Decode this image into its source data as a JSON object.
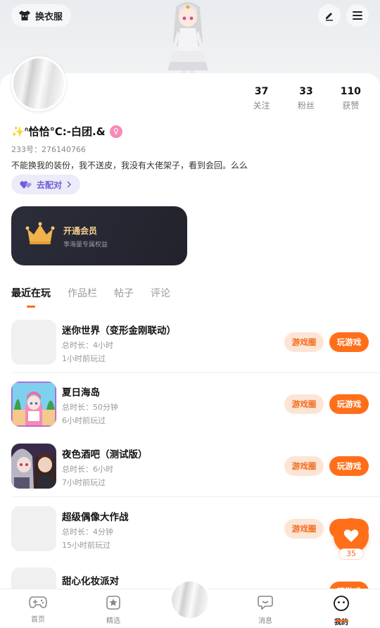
{
  "header": {
    "wardrobe_label": "换衣服",
    "icons": [
      "shirt-icon",
      "edit-icon",
      "menu-icon"
    ]
  },
  "profile": {
    "stats": [
      {
        "value": "37",
        "label": "关注"
      },
      {
        "value": "33",
        "label": "粉丝"
      },
      {
        "value": "110",
        "label": "获赞"
      }
    ],
    "nickname": "✨ᐢ恰恰℃:-白团.&",
    "gender_symbol": "♀",
    "uid": "233号：276140766",
    "bio": "不能换我的装份，我不送皮，我没有大佬架子，看到会回。么么",
    "match_label": "去配对"
  },
  "vip": {
    "title": "开通会员",
    "subtitle": "享海量专属权益"
  },
  "tabs": [
    {
      "label": "最近在玩",
      "active": true
    },
    {
      "label": "作品栏",
      "active": false
    },
    {
      "label": "帖子",
      "active": false
    },
    {
      "label": "评论",
      "active": false
    }
  ],
  "games": [
    {
      "name": "迷你世界（变形金刚联动）",
      "duration": "总时长：4小时",
      "last_played": "1小时前玩过",
      "circle_label": "游戏圈",
      "play_label": "玩游戏"
    },
    {
      "name": "夏日海岛",
      "duration": "总时长：50分钟",
      "last_played": "6小时前玩过",
      "circle_label": "游戏圈",
      "play_label": "玩游戏"
    },
    {
      "name": "夜色酒吧（测试版）",
      "duration": "总时长：6小时",
      "last_played": "7小时前玩过",
      "circle_label": "游戏圈",
      "play_label": "玩游戏"
    },
    {
      "name": "超级偶像大作战",
      "duration": "总时长：4分钟",
      "last_played": "15小时前玩过",
      "circle_label": "游戏圈",
      "play_label": "玩游戏"
    },
    {
      "name": "甜心化妆派对",
      "duration": "",
      "last_played": "",
      "circle_label": "",
      "play_label": "玩游戏"
    }
  ],
  "like_fab": {
    "count": "35"
  },
  "bottom_nav": [
    {
      "label": "首页",
      "icon": "gamepad-icon",
      "active": false
    },
    {
      "label": "精选",
      "icon": "star-icon",
      "active": false
    },
    {
      "label": "消息",
      "icon": "chat-icon",
      "active": false
    },
    {
      "label": "我的",
      "icon": "smile-icon",
      "active": true
    }
  ],
  "colors": {
    "accent": "#ff6f1a",
    "accent_light": "#fde5d6",
    "match_purple": "#6c5fd8",
    "vip_gold": "#f3d28d"
  }
}
